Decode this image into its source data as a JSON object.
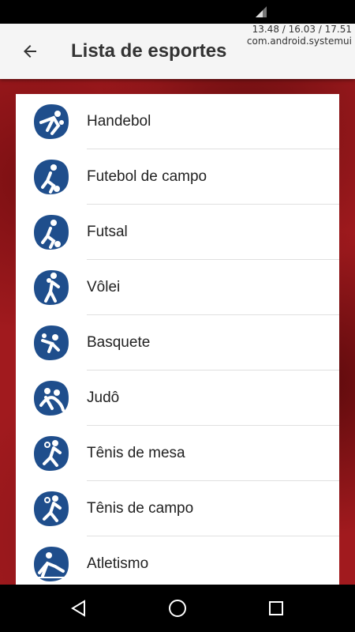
{
  "status_bar": {
    "debug_line_1": "13.48 / 16.03 / 17.51",
    "debug_line_2": "com.android.systemui"
  },
  "app_bar": {
    "back_icon": "arrow-back-icon",
    "title": "Lista de esportes"
  },
  "colors": {
    "app_bar": "#f5f5f5",
    "icon_blue": "#1f4e8c",
    "background_red": "#a11a1e"
  },
  "sports": [
    {
      "label": "Handebol",
      "icon": "handball-icon"
    },
    {
      "label": "Futebol de campo",
      "icon": "football-icon"
    },
    {
      "label": "Futsal",
      "icon": "futsal-icon"
    },
    {
      "label": "Vôlei",
      "icon": "volleyball-icon"
    },
    {
      "label": "Basquete",
      "icon": "basketball-icon"
    },
    {
      "label": "Judô",
      "icon": "judo-icon"
    },
    {
      "label": "Tênis de mesa",
      "icon": "table-tennis-icon"
    },
    {
      "label": "Tênis de campo",
      "icon": "tennis-icon"
    },
    {
      "label": "Atletismo",
      "icon": "athletics-icon"
    }
  ],
  "nav_bar": {
    "back": "nav-back-icon",
    "home": "nav-home-icon",
    "recents": "nav-recents-icon"
  }
}
